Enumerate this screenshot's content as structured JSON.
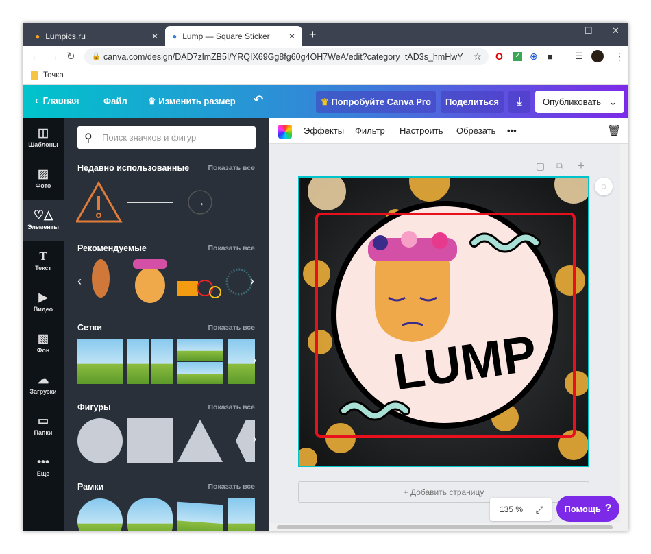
{
  "browser": {
    "tabs": [
      {
        "title": "Lumpics.ru"
      },
      {
        "title": "Lump — Square Sticker"
      }
    ],
    "url": "canva.com/design/DAD7zlmZB5I/YRQIX69Gg8fg60g4OH7WeA/edit?category=tAD3s_hmHwY",
    "bookmark": "Точка"
  },
  "header": {
    "home": "Главная",
    "file": "Файл",
    "resize": "Изменить размер",
    "try_pro": "Попробуйте Canva Pro",
    "share": "Поделиться",
    "publish": "Опубликовать"
  },
  "sidebar": {
    "items": [
      {
        "label": "Шаблоны",
        "icon": "template-icon"
      },
      {
        "label": "Фото",
        "icon": "photo-icon"
      },
      {
        "label": "Элементы",
        "icon": "elements-icon"
      },
      {
        "label": "Текст",
        "icon": "text-icon"
      },
      {
        "label": "Видео",
        "icon": "video-icon"
      },
      {
        "label": "Фон",
        "icon": "background-icon"
      },
      {
        "label": "Загрузки",
        "icon": "upload-icon"
      },
      {
        "label": "Папки",
        "icon": "folder-icon"
      },
      {
        "label": "Еще",
        "icon": "more-icon"
      }
    ]
  },
  "panel": {
    "search_placeholder": "Поиск значков и фигур",
    "show_all": "Показать все",
    "sections": [
      "Недавно использованные",
      "Рекомендуемые",
      "Сетки",
      "Фигуры",
      "Рамки"
    ]
  },
  "toolbar": {
    "effects": "Эффекты",
    "filter": "Фильтр",
    "adjust": "Настроить",
    "crop": "Обрезать",
    "more": "•••"
  },
  "canvas": {
    "design_text": "LUMP",
    "add_page": "+ Добавить страницу",
    "zoom": "135 %",
    "help": "Помощь",
    "help_icon": "?"
  },
  "colors": {
    "accent": "#7d2ae8",
    "teal": "#00c4cc",
    "selection": "#e8101c"
  }
}
